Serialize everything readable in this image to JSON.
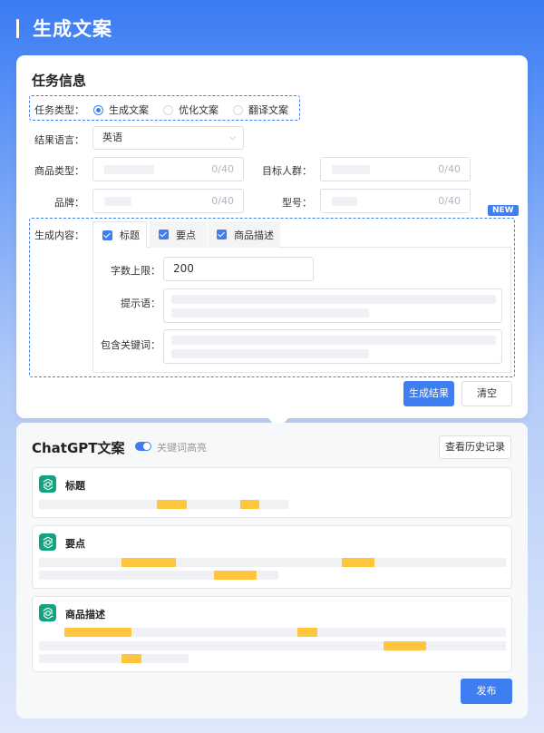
{
  "header": {
    "title": "生成文案"
  },
  "task": {
    "title": "任务信息",
    "task_type_label": "任务类型：",
    "task_types": [
      {
        "label": "生成文案",
        "selected": true
      },
      {
        "label": "优化文案",
        "selected": false
      },
      {
        "label": "翻译文案",
        "selected": false
      }
    ],
    "language_label": "结果语言：",
    "language_value": "英语",
    "product_type_label": "商品类型：",
    "product_type_count": "0/40",
    "audience_label": "目标人群：",
    "audience_count": "0/40",
    "brand_label": "品牌：",
    "brand_count": "0/40",
    "model_label": "型号：",
    "model_count": "0/40",
    "new_badge": "NEW",
    "content_label": "生成内容：",
    "tabs": [
      "标题",
      "要点",
      "商品描述"
    ],
    "word_limit_label": "字数上限：",
    "word_limit_value": "200",
    "prompt_label": "提示语：",
    "keywords_label": "包含关键词：",
    "generate_button": "生成结果",
    "clear_button": "清空"
  },
  "results": {
    "title": "ChatGPT文案",
    "highlight_toggle_label": "关键词高亮",
    "highlight_on": true,
    "history_button": "查看历史记录",
    "cards": [
      {
        "title": "标题"
      },
      {
        "title": "要点"
      },
      {
        "title": "商品描述"
      }
    ],
    "publish_button": "发布"
  },
  "colors": {
    "accent": "#3f7ef0",
    "highlight": "#ffc53d",
    "gpt_green": "#11a37f"
  }
}
